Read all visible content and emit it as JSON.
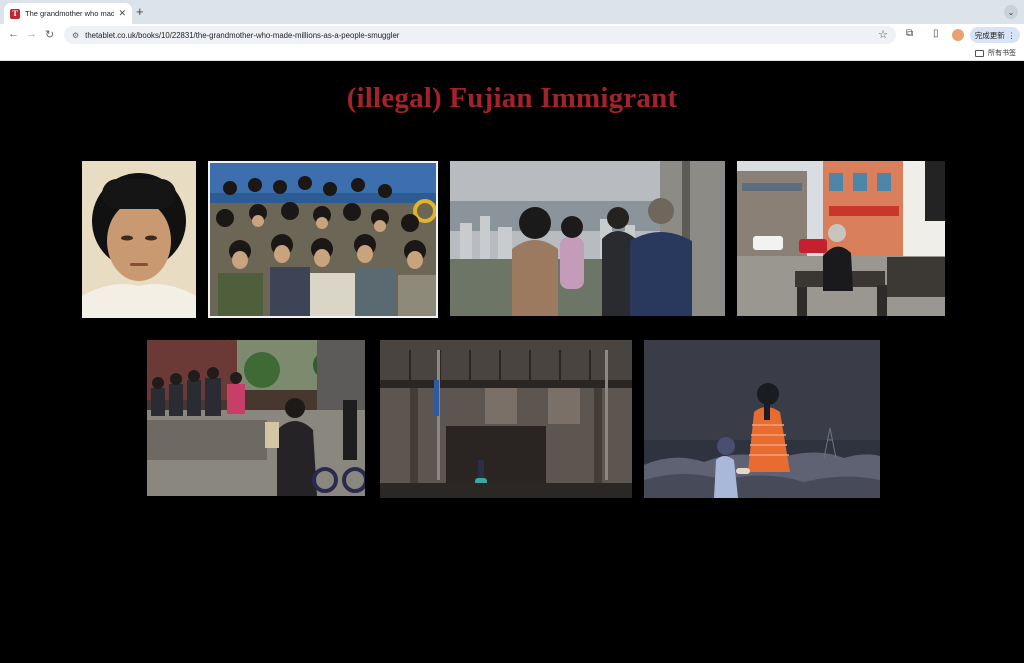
{
  "browser": {
    "tab_title": "The grandmother who made millions as a people smuggler",
    "favicon_letter": "T",
    "url": "thetablet.co.uk/books/10/22831/the-grandmother-who-made-millions-as-a-people-smuggler",
    "update_button": "完成更新",
    "bookmarks_all": "所有书签"
  },
  "page": {
    "heading": "(illegal) Fujian Immigrant"
  },
  "icons": {
    "back": "arrow-left-icon",
    "forward": "arrow-right-icon",
    "reload": "reload-icon",
    "site_info": "tune-icon",
    "bookmark": "star-icon",
    "extensions": "puzzle-icon",
    "side_panel": "side-panel-icon",
    "menu": "more-vert-icon",
    "folder": "folder-icon"
  },
  "colors": {
    "heading": "#a6222b",
    "background": "#000000"
  }
}
